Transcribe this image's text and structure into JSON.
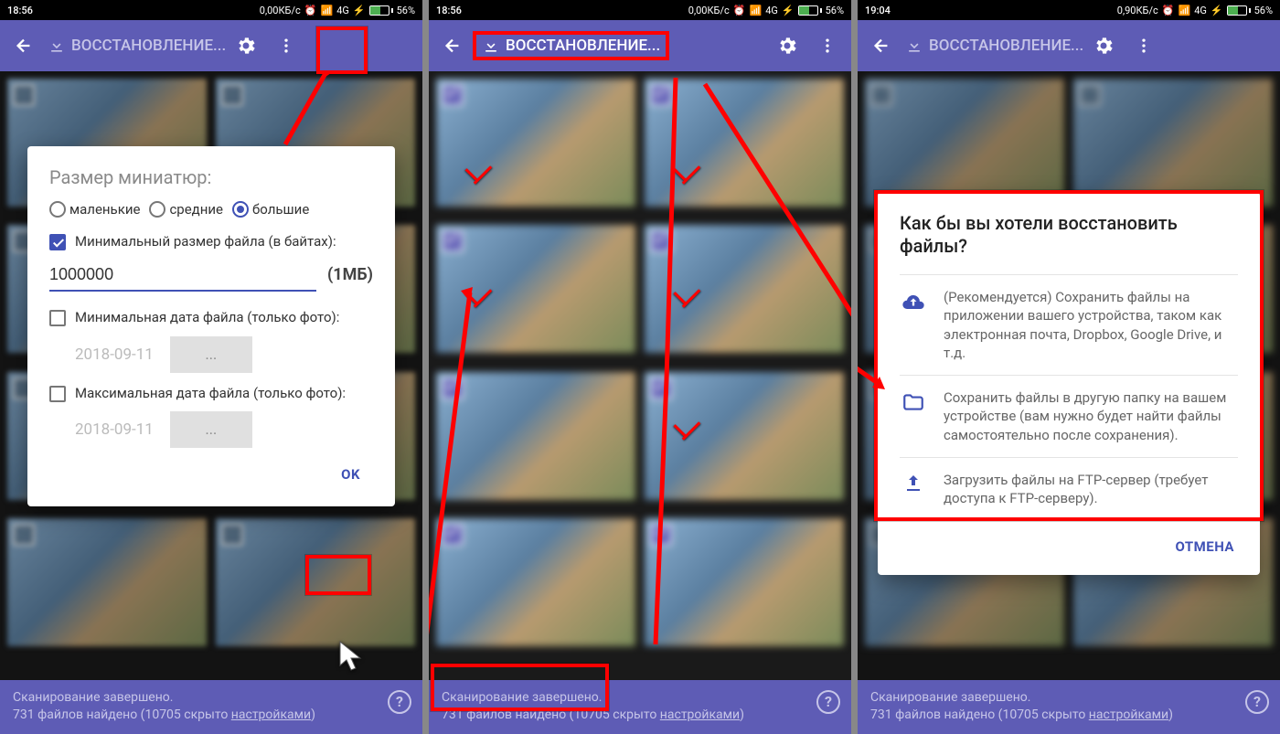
{
  "status": {
    "time1": "18:56",
    "time2": "18:56",
    "time3": "19:04",
    "net1": "0,00КБ/с",
    "net2": "0,00КБ/с",
    "net3": "0,90КБ/с",
    "sig": "4G",
    "batt": "56%"
  },
  "appbar": {
    "title": "ВОССТАНОВЛЕНИЕ..."
  },
  "dialog1": {
    "title": "Размер миниатюр:",
    "radio_small": "маленькие",
    "radio_medium": "средние",
    "radio_large": "большие",
    "chk_minsize": "Минимальный размер файла (в байтах):",
    "minsize_value": "1000000",
    "minsize_hint": "(1МБ)",
    "chk_mindate": "Минимальная дата файла (только фото):",
    "mindate_value": "2018-09-11",
    "mindate_btn": "...",
    "chk_maxdate": "Максимальная дата файла (только фото):",
    "maxdate_value": "2018-09-11",
    "maxdate_btn": "...",
    "ok": "OK"
  },
  "dialog3": {
    "title": "Как бы вы хотели восстановить файлы?",
    "opt1": "(Рекомендуется) Сохранить файлы на приложении вашего устройства, таком как электронная почта, Dropbox, Google Drive, и т.д.",
    "opt2": "Сохранить файлы в другую папку на вашем устройстве (вам нужно будет найти файлы самостоятельно после сохранения).",
    "opt3": "Загрузить файлы на FTP-сервер (требует доступа к FTP-серверу).",
    "cancel": "ОТМЕНА"
  },
  "footer": {
    "line1": "Сканирование завершено.",
    "line2a": "731 файлов найдено",
    "line2b": " (10705 скрыто ",
    "line2c": "настройками",
    "line2d": ")"
  }
}
